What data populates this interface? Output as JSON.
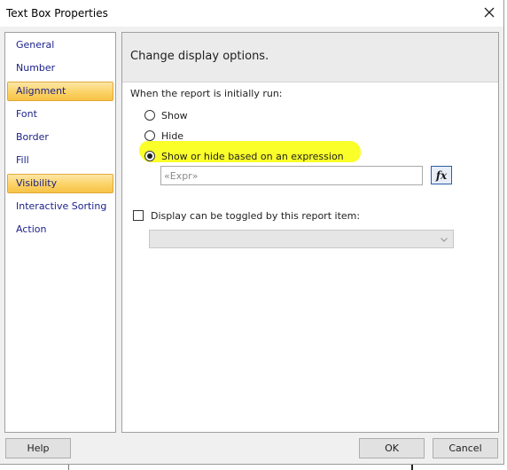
{
  "window": {
    "title": "Text Box Properties"
  },
  "sidebar": {
    "items": [
      {
        "label": "General",
        "selected": false
      },
      {
        "label": "Number",
        "selected": false
      },
      {
        "label": "Alignment",
        "selected": true
      },
      {
        "label": "Font",
        "selected": false
      },
      {
        "label": "Border",
        "selected": false
      },
      {
        "label": "Fill",
        "selected": false
      },
      {
        "label": "Visibility",
        "selected": true
      },
      {
        "label": "Interactive Sorting",
        "selected": false
      },
      {
        "label": "Action",
        "selected": false
      }
    ]
  },
  "content": {
    "header": "Change display options.",
    "section_label": "When the report is initially run:",
    "radios": [
      {
        "label": "Show",
        "checked": false
      },
      {
        "label": "Hide",
        "checked": false
      },
      {
        "label": "Show or hide based on an expression",
        "checked": true
      }
    ],
    "expression": {
      "value": "«Expr»"
    },
    "fx_label": "fx",
    "toggle": {
      "label": "Display can be toggled by this report item:",
      "checked": false
    },
    "toggle_combo": {
      "value": ""
    }
  },
  "buttons": {
    "help": "Help",
    "ok": "OK",
    "cancel": "Cancel"
  },
  "colors": {
    "highlight": "#fbff1e",
    "nav_text": "#1a1f8a",
    "selected_bg": "#fbd46a"
  }
}
